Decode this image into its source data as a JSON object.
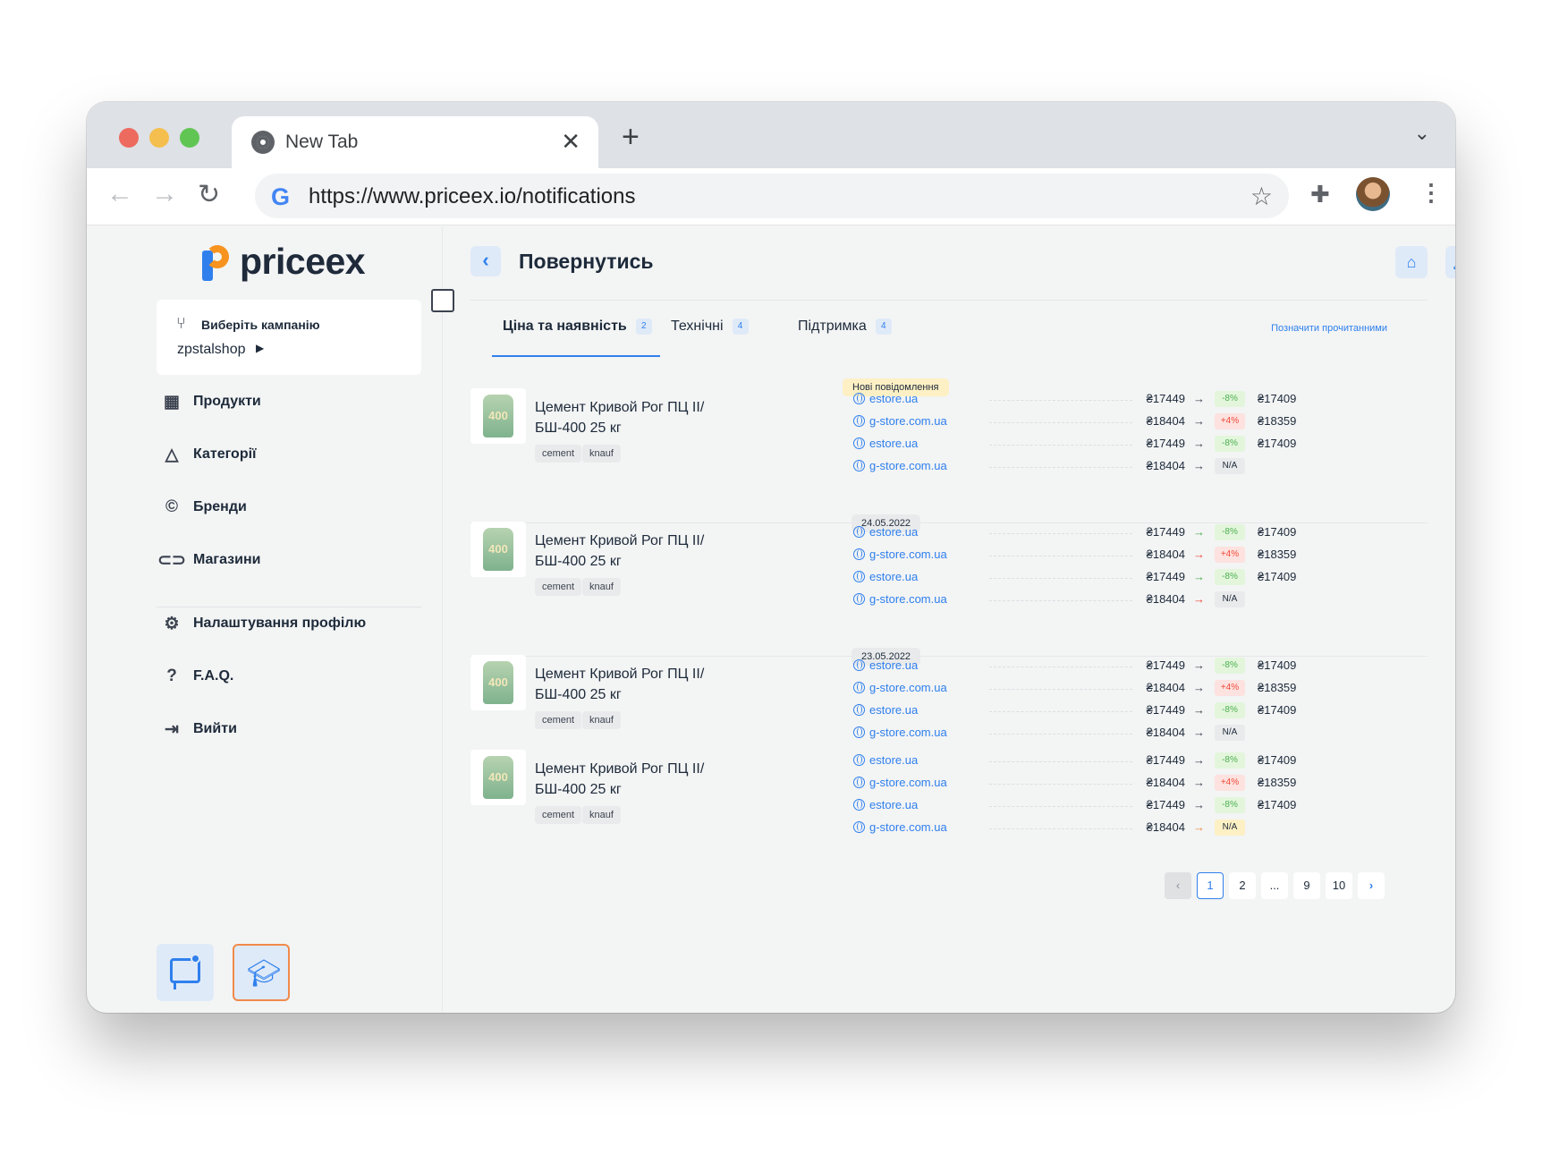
{
  "browser": {
    "tab_title": "New Tab",
    "url": "https://www.priceex.io/notifications",
    "new_tab_glyph": "+",
    "close_glyph": "✕"
  },
  "app": {
    "brand": "priceex",
    "campaign": {
      "label": "Виберіть кампанію",
      "value": "zpstalshop"
    },
    "menu": [
      {
        "label": "Продукти",
        "icon": "grid-icon"
      },
      {
        "label": "Категорії",
        "icon": "shapes-icon"
      },
      {
        "label": "Бренди",
        "icon": "copyright-icon"
      },
      {
        "label": "Магазини",
        "icon": "link-icon"
      },
      {
        "label": "Налаштування профілю",
        "icon": "user-settings-icon"
      },
      {
        "label": "F.A.Q.",
        "icon": "question-icon"
      },
      {
        "label": "Вийти",
        "icon": "logout-icon"
      }
    ]
  },
  "main": {
    "back_label": "Повернутись",
    "tabs": [
      {
        "label": "Ціна та наявність",
        "count": "2"
      },
      {
        "label": "Технічні",
        "count": "4"
      },
      {
        "label": "Підтримка",
        "count": "4"
      }
    ],
    "mark_read": "Позначити прочитанними",
    "new_messages": "Нові повідомлення",
    "dates": [
      "24.05.2022",
      "23.05.2022"
    ],
    "product": {
      "name_line1": "Цемент Кривой Рог ПЦ II/",
      "name_line2": "БШ-400 25 кг",
      "tags": [
        "cement",
        "knauf"
      ],
      "bag_label": "400"
    },
    "groups": [
      {
        "rows": [
          {
            "store": "estore.ua",
            "old": "₴17449",
            "arrow": "neutral",
            "chg": "-8%",
            "kind": "down",
            "new": "₴17409"
          },
          {
            "store": "g-store.com.ua",
            "old": "₴18404",
            "arrow": "neutral",
            "chg": "+4%",
            "kind": "up",
            "new": "₴18359"
          },
          {
            "store": "estore.ua",
            "old": "₴17449",
            "arrow": "neutral",
            "chg": "-8%",
            "kind": "down",
            "new": "₴17409"
          },
          {
            "store": "g-store.com.ua",
            "old": "₴18404",
            "arrow": "neutral",
            "chg": "N/A",
            "kind": "na",
            "new": ""
          }
        ]
      },
      {
        "rows": [
          {
            "store": "estore.ua",
            "old": "₴17449",
            "arrow": "green",
            "chg": "-8%",
            "kind": "down",
            "new": "₴17409"
          },
          {
            "store": "g-store.com.ua",
            "old": "₴18404",
            "arrow": "red",
            "chg": "+4%",
            "kind": "up",
            "new": "₴18359"
          },
          {
            "store": "estore.ua",
            "old": "₴17449",
            "arrow": "green",
            "chg": "-8%",
            "kind": "down",
            "new": "₴17409"
          },
          {
            "store": "g-store.com.ua",
            "old": "₴18404",
            "arrow": "red",
            "chg": "N/A",
            "kind": "na",
            "new": ""
          }
        ]
      },
      {
        "rows": [
          {
            "store": "estore.ua",
            "old": "₴17449",
            "arrow": "neutral",
            "chg": "-8%",
            "kind": "down",
            "new": "₴17409"
          },
          {
            "store": "g-store.com.ua",
            "old": "₴18404",
            "arrow": "neutral",
            "chg": "+4%",
            "kind": "up",
            "new": "₴18359"
          },
          {
            "store": "estore.ua",
            "old": "₴17449",
            "arrow": "neutral",
            "chg": "-8%",
            "kind": "down",
            "new": "₴17409"
          },
          {
            "store": "g-store.com.ua",
            "old": "₴18404",
            "arrow": "neutral",
            "chg": "N/A",
            "kind": "na",
            "new": ""
          }
        ]
      },
      {
        "rows": [
          {
            "store": "estore.ua",
            "old": "₴17449",
            "arrow": "neutral",
            "chg": "-8%",
            "kind": "down",
            "new": "₴17409"
          },
          {
            "store": "g-store.com.ua",
            "old": "₴18404",
            "arrow": "neutral",
            "chg": "+4%",
            "kind": "up",
            "new": "₴18359"
          },
          {
            "store": "estore.ua",
            "old": "₴17449",
            "arrow": "neutral",
            "chg": "-8%",
            "kind": "down",
            "new": "₴17409"
          },
          {
            "store": "g-store.com.ua",
            "old": "₴18404",
            "arrow": "orange",
            "chg": "N/A",
            "kind": "na-y",
            "new": ""
          }
        ]
      }
    ],
    "pagination": [
      "1",
      "2",
      "...",
      "9",
      "10"
    ],
    "current_page": "1"
  }
}
